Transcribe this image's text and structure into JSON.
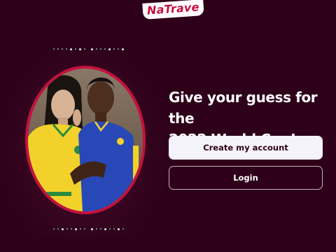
{
  "app": {
    "logo_text": "NaTrave"
  },
  "hero": {
    "image_alt": "Two people wearing Brazil football jerseys",
    "headline_line1": "Give your guess for the",
    "headline_line2": "2022 World Cup!"
  },
  "actions": {
    "create_account_label": "Create my account",
    "login_label": "Login"
  },
  "colors": {
    "background": "#2e0019",
    "brand_red": "#c4123f",
    "button_light": "#f5f3fb"
  }
}
